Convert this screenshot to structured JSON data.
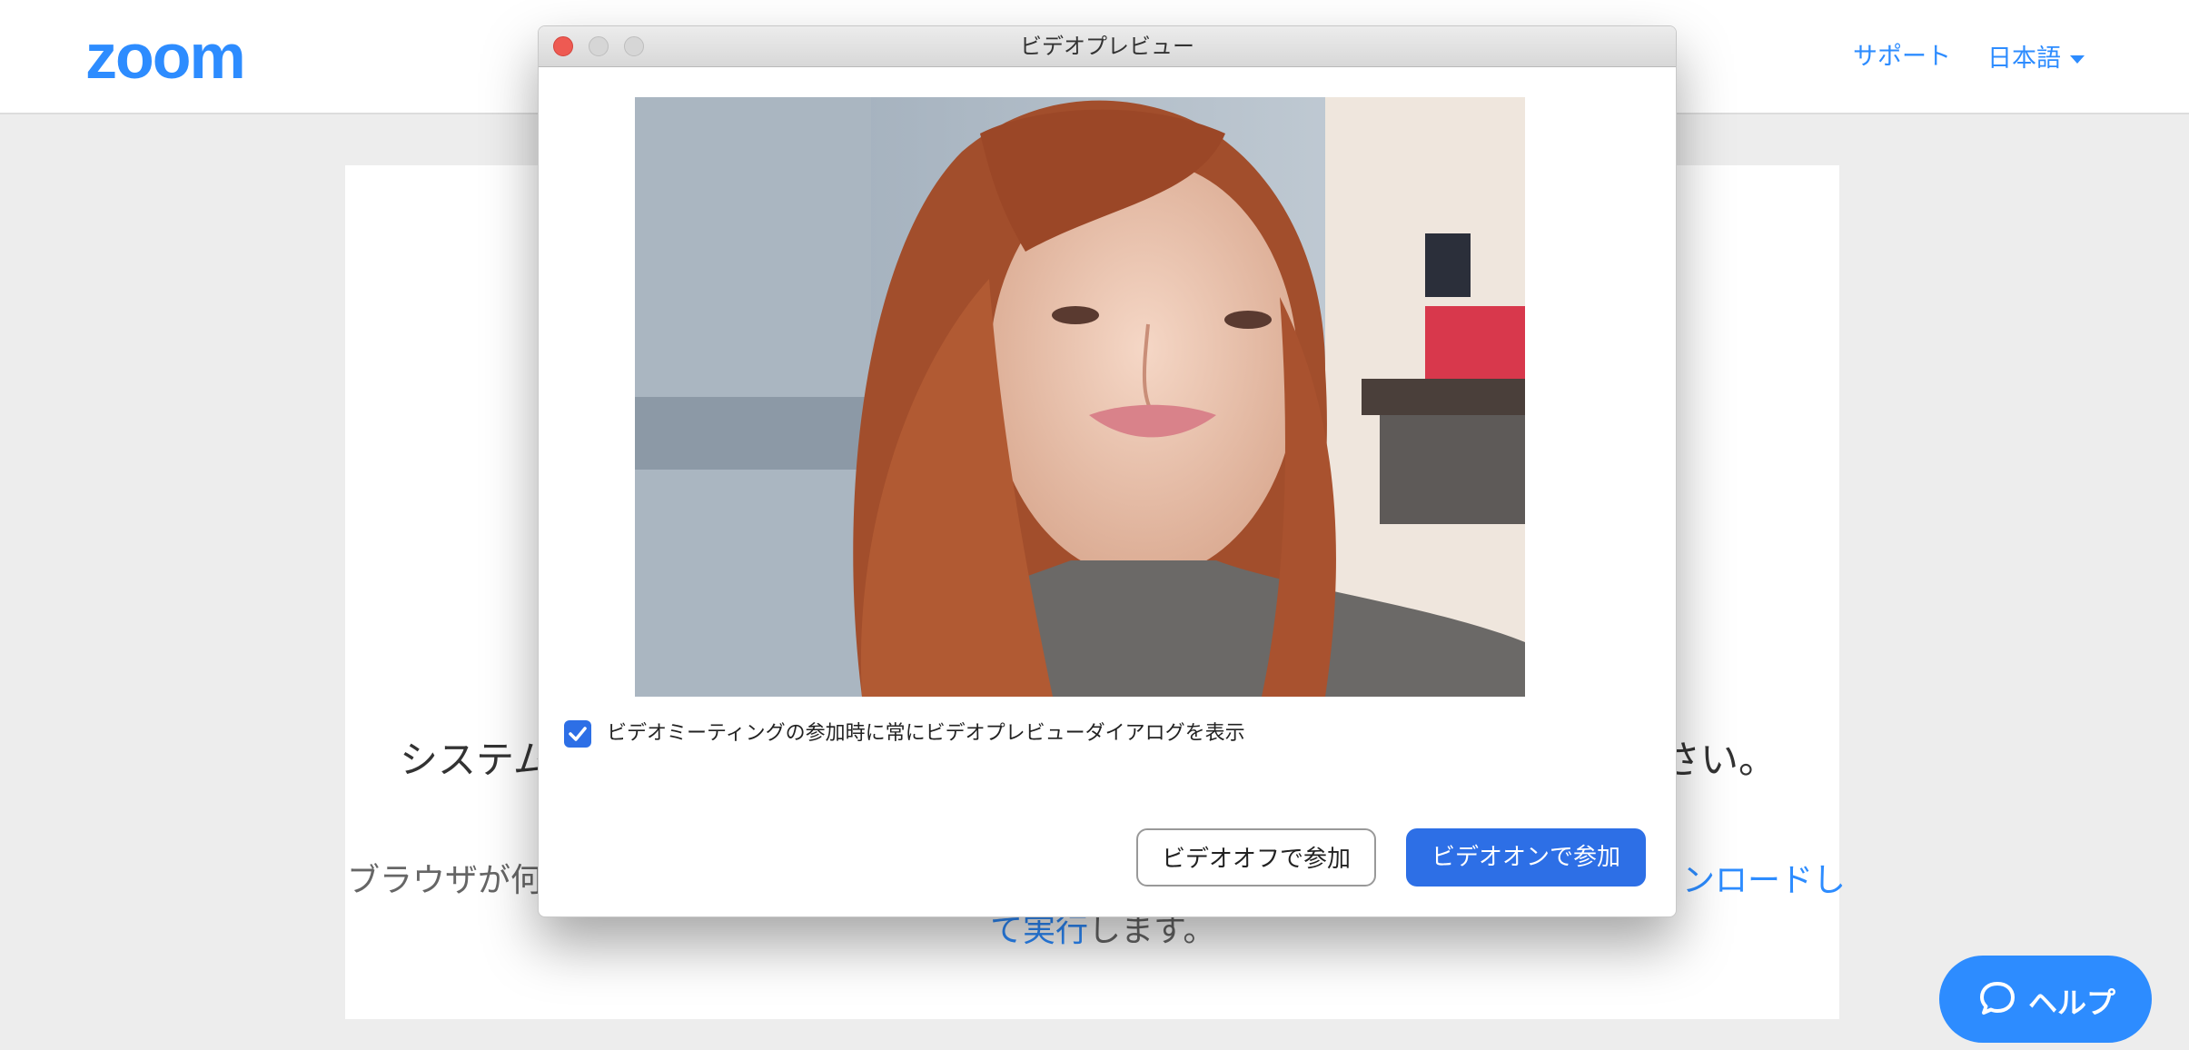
{
  "header": {
    "logo": "zoom",
    "support_label": "サポート",
    "language_label": "日本語"
  },
  "background": {
    "headline_left": "システム",
    "headline_right": "さい。",
    "sub_left": "ブラウザが何",
    "sub_right_link": "ンロードし",
    "sub_line2_link": "て実行",
    "sub_line2_rest": "します。"
  },
  "dialog": {
    "title": "ビデオプレビュー",
    "checkbox_label": "ビデオミーティングの参加時に常にビデオプレビューダイアログを表示",
    "checkbox_checked": true,
    "btn_video_off": "ビデオオフで参加",
    "btn_video_on": "ビデオオンで参加"
  },
  "help": {
    "label": "ヘルプ"
  },
  "colors": {
    "brand_blue": "#2d8cff",
    "primary_button": "#2d6fe6",
    "close_red": "#ee5a52"
  }
}
